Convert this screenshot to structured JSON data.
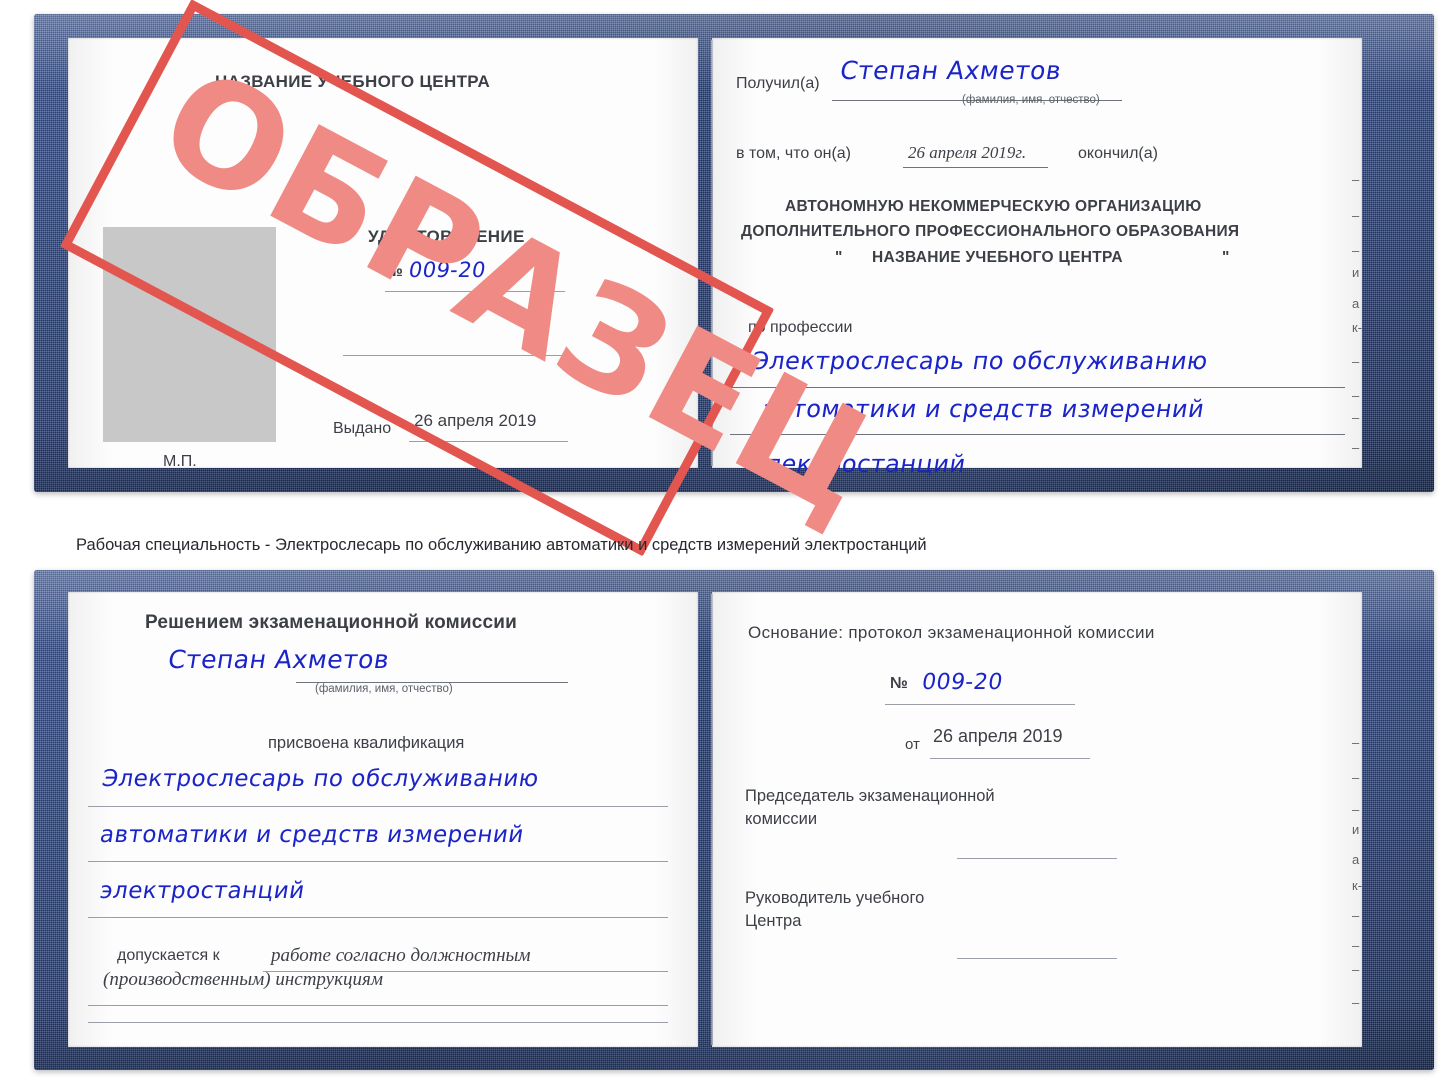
{
  "caption": "Рабочая специальность - Электрослесарь по обслуживанию автоматики и средств измерений электростанций",
  "watermark": {
    "text": "ОБРАЗЕЦ",
    "color": "#e2564f",
    "text_color": "#ef8a85"
  },
  "colors": {
    "cover_blue": "#2d4a87",
    "paper": "#fdfdfd",
    "ink_blue": "#1b24c8",
    "rule_gray": "#9a9ea6",
    "photo_gray": "#c8c8c8"
  },
  "cert_top": {
    "left_page": {
      "org_title": "НАЗВАНИЕ УЧЕБНОГО ЦЕНТРА",
      "doc_type": "УДОСТОВЕРЕНИЕ",
      "number_label": "№",
      "number_value": "009-20",
      "issued_label": "Выдано",
      "issued_value": "26 апреля 2019",
      "seal_label": "М.П.",
      "photo_placeholder": "photo-area"
    },
    "right_page": {
      "received_label": "Получил(а)",
      "received_value": "Степан Ахметов",
      "fio_hint": "(фамилия, имя, отчество)",
      "in_that_label": "в том, что он(а)",
      "in_that_value": "26 апреля 2019г.",
      "finished_label": "окончил(а)",
      "org_line1": "АВТОНОМНУЮ НЕКОММЕРЧЕСКУЮ ОРГАНИЗАЦИЮ",
      "org_line2": "ДОПОЛНИТЕЛЬНОГО ПРОФЕССИОНАЛЬНОГО ОБРАЗОВАНИЯ",
      "org_quote_open": "\"",
      "org_line3": "НАЗВАНИЕ УЧЕБНОГО ЦЕНТРА",
      "org_quote_close": "\"",
      "profession_label": "по профессии",
      "profession_line1": "Электрослесарь по обслуживанию",
      "profession_line2": "автоматики и средств измерений",
      "profession_line3": "электростанций",
      "bleed_marks": [
        "–",
        "–",
        "–",
        "и",
        "а",
        "к-",
        "–",
        "–",
        "–",
        "–"
      ]
    }
  },
  "cert_bottom": {
    "left_page": {
      "decision_title": "Решением экзаменационной комиссии",
      "name_value": "Степан Ахметов",
      "fio_hint": "(фамилия, имя, отчество)",
      "qualification_label": "присвоена квалификация",
      "qualification_line1": "Электрослесарь по обслуживанию",
      "qualification_line2": "автоматики и средств измерений",
      "qualification_line3": "электростанций",
      "allowed_label": "допускается к",
      "allowed_value_line1": "работе согласно должностным",
      "allowed_value_line2": "(производственным) инструкциям"
    },
    "right_page": {
      "basis_label": "Основание: протокол экзаменационной комиссии",
      "number_label": "№",
      "number_value": "009-20",
      "date_label": "от",
      "date_value": "26 апреля 2019",
      "chairman_line1": "Председатель экзаменационной",
      "chairman_line2": "комиссии",
      "head_line1": "Руководитель учебного",
      "head_line2": "Центра",
      "bleed_marks": [
        "–",
        "–",
        "–",
        "и",
        "а",
        "к-",
        "–",
        "–",
        "–",
        "–"
      ]
    }
  }
}
